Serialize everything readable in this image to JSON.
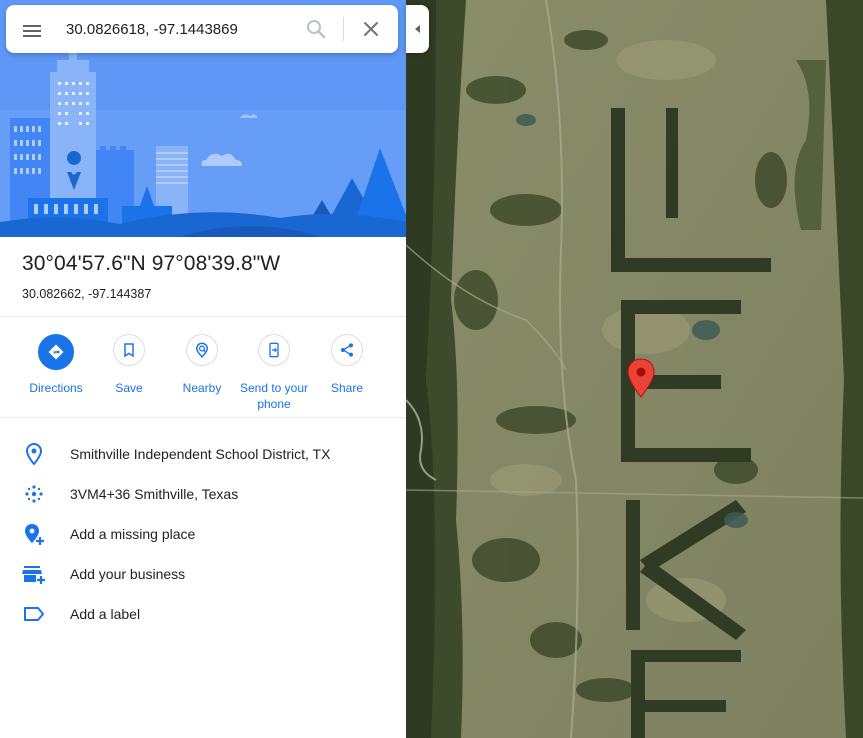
{
  "search": {
    "value": "30.0826618, -97.1443869",
    "menu_icon": "menu-icon",
    "search_icon": "search-icon",
    "close_icon": "close-icon"
  },
  "place": {
    "title": "30°04'57.6\"N 97°08'39.8\"W",
    "subtitle": "30.082662, -97.144387"
  },
  "actions": [
    {
      "label": "Directions",
      "icon": "directions-icon"
    },
    {
      "label": "Save",
      "icon": "bookmark-icon"
    },
    {
      "label": "Nearby",
      "icon": "nearby-icon"
    },
    {
      "label": "Send to your phone",
      "icon": "send-to-phone-icon"
    },
    {
      "label": "Share",
      "icon": "share-icon"
    }
  ],
  "info": [
    {
      "text": "Smithville Independent School District, TX",
      "icon": "place-pin-icon"
    },
    {
      "text": "3VM4+36 Smithville, Texas",
      "icon": "plus-code-icon"
    },
    {
      "text": "Add a missing place",
      "icon": "add-place-icon"
    },
    {
      "text": "Add your business",
      "icon": "add-business-icon"
    },
    {
      "text": "Add a label",
      "icon": "label-icon"
    }
  ],
  "colors": {
    "accent": "#1a73e8",
    "hero_bg": "#5e97f6",
    "pin": "#ea4335"
  }
}
